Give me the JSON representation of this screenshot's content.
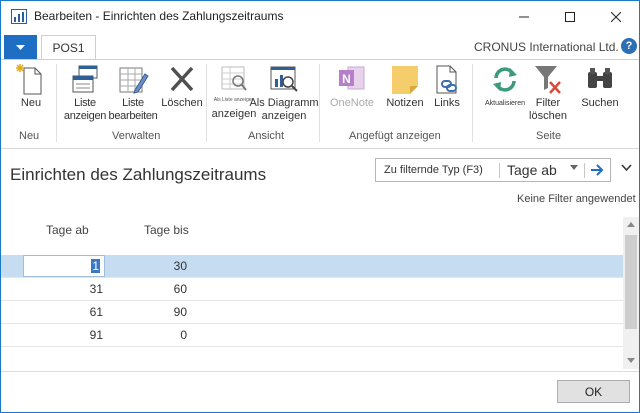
{
  "window": {
    "title": "Bearbeiten - Einrichten des Zahlungszeitraums"
  },
  "ribbon_tabs": {
    "active_tab": "POS1",
    "company": "CRONUS International Ltd.",
    "help": "?"
  },
  "ribbon": {
    "groups": [
      {
        "label": "Neu"
      },
      {
        "label": "Verwalten"
      },
      {
        "label": "Ansicht"
      },
      {
        "label": "Angefügt anzeigen"
      },
      {
        "label": "Seite"
      }
    ],
    "buttons": {
      "neu": {
        "label": "Neu",
        "icon": "new-document-icon"
      },
      "liste_anzeigen": {
        "label": "Liste\nanzeigen",
        "icon": "view-list-icon"
      },
      "liste_bearbeiten": {
        "label": "Liste\nbearbeiten",
        "icon": "edit-list-icon"
      },
      "loeschen": {
        "label": "Löschen",
        "icon": "delete-x-icon"
      },
      "als_liste_anzeigen": {
        "label_small": "Als Liste anzeigen",
        "label": "anzeigen",
        "icon": "show-as-list-icon"
      },
      "als_diagramm": {
        "label": "Als Diagramm\nanzeigen",
        "icon": "show-as-chart-icon"
      },
      "onenote": {
        "label": "OneNote",
        "icon": "onenote-icon",
        "disabled": true
      },
      "notizen": {
        "label": "Notizen",
        "icon": "notes-icon"
      },
      "links": {
        "label": "Links",
        "icon": "links-icon"
      },
      "aktualisieren": {
        "label": "Aktualisieren",
        "icon": "refresh-icon"
      },
      "filter_loeschen": {
        "label": "Filter\nlöschen",
        "icon": "clear-filter-icon"
      },
      "suchen": {
        "label": "Suchen",
        "icon": "binoculars-icon"
      }
    }
  },
  "page": {
    "title": "Einrichten des Zahlungszeitraums",
    "filter": {
      "type_label": "Zu filternde Typ (F3)",
      "field": "Tage ab"
    },
    "no_filter": "Keine Filter angewendet"
  },
  "table": {
    "columns": [
      "Tage ab",
      "Tage bis"
    ],
    "rows": [
      {
        "from": "1",
        "to": "30"
      },
      {
        "from": "31",
        "to": "60"
      },
      {
        "from": "61",
        "to": "90"
      },
      {
        "from": "91",
        "to": "0"
      }
    ]
  },
  "footer": {
    "ok": "OK"
  },
  "colors": {
    "accent": "#1e6fc4",
    "selected_row": "#c5dcf1"
  }
}
